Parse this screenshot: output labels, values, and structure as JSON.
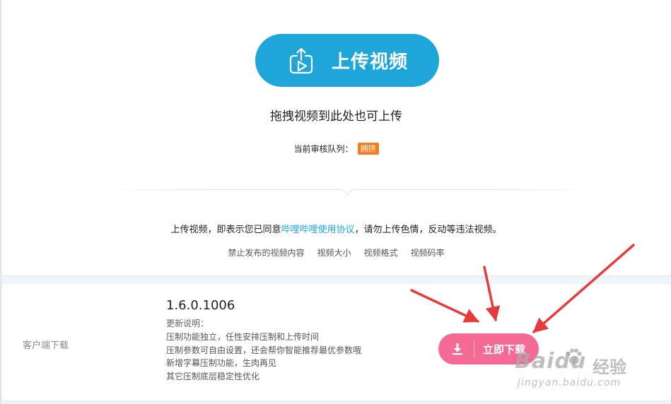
{
  "upload": {
    "button_label": "上传视频",
    "drag_hint": "拖拽视频到此处也可上传",
    "queue_label": "当前审核队列：",
    "queue_status": "拥挤",
    "agreement_prefix": "上传视频，即表示您已同意",
    "agreement_link": "哔哩哔哩使用协议",
    "agreement_suffix": "，请勿上传色情，反动等违法视频。",
    "rule_links": [
      "禁止发布的视频内容",
      "视频大小",
      "视频格式",
      "视频码率"
    ]
  },
  "client": {
    "section_label": "客户端下载",
    "version": "1.6.0.1006",
    "notes_title": "更新说明：",
    "notes": [
      "压制功能独立，任性安排压制和上传时间",
      "压制参数可自由设置，还会帮你智能推荐最优参数哦",
      "新增字幕压制功能，生肉再见",
      "其它压制底层稳定性优化"
    ],
    "download_label": "立即下载"
  },
  "watermark": {
    "logo": "Bai",
    "logo_tail": "du",
    "sub": "经验",
    "url": "jingyan.baidu.com"
  },
  "colors": {
    "upload_button": "#1fa6d8",
    "download_button": "#f36a95",
    "queue_badge": "#f57c22",
    "annotation_arrow": "#e83a3a"
  },
  "icons": {
    "upload": "upload-video-icon",
    "download": "download-icon"
  }
}
